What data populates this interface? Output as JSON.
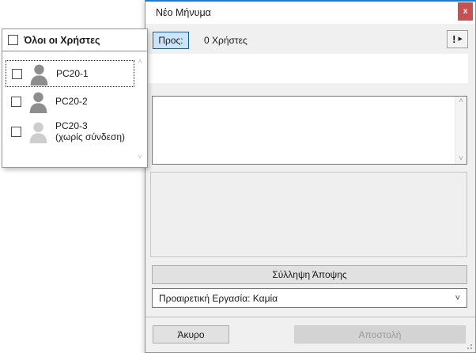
{
  "window": {
    "title": "Νέο Μήνυμα"
  },
  "toolbar": {
    "to_button_label": "Προς:",
    "recipients_count": "0 Χρήστες"
  },
  "icons": {
    "close": "x",
    "priority_exclaim": "!",
    "priority_arrow": "▶",
    "scroll_up": "˄",
    "scroll_down": "˅",
    "combo_chevron": "˅"
  },
  "user_panel": {
    "select_all_label": "Όλοι οι Χρήστες",
    "users": [
      {
        "name": "PC20-1",
        "status": "",
        "online": true,
        "checked": false
      },
      {
        "name": "PC20-2",
        "status": "",
        "online": true,
        "checked": false
      },
      {
        "name": "PC20-3",
        "status": "(χωρίς σύνδεση)",
        "online": false,
        "checked": false
      }
    ]
  },
  "message": {
    "value": ""
  },
  "actions": {
    "capture_button": "Σύλληψη Άποψης",
    "task_dropdown_value": "Προαιρετική Εργασία: Καμία",
    "cancel_button": "Άκυρο",
    "send_button": "Αποστολή",
    "send_enabled": false
  },
  "colors": {
    "accent_blue": "#005fb8",
    "titlebar_top_border": "#1d7dd2",
    "close_button_red": "#c75050",
    "to_button_bg": "#cce4f7",
    "user_online_icon": "#8d8d8d",
    "user_offline_icon": "#cdcdcd",
    "dialog_bg": "#f0f0f0"
  }
}
